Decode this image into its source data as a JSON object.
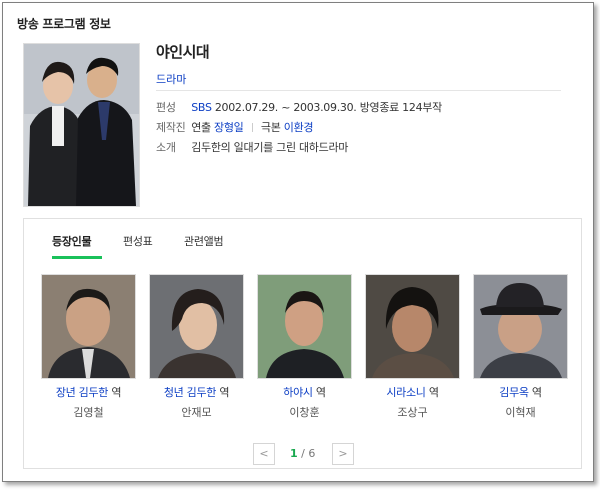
{
  "header": {
    "title": "방송 프로그램 정보"
  },
  "program": {
    "title": "야인시대",
    "genre": "드라마",
    "schedule_label": "편성",
    "network": "SBS",
    "schedule_text": "2002.07.29. ~ 2003.09.30. 방영종료 124부작",
    "staff_label": "제작진",
    "director_label": "연출",
    "director": "장형일",
    "writer_label": "극본",
    "writer": "이환경",
    "intro_label": "소개",
    "intro": "김두한의 일대기를 그린 대하드라마"
  },
  "tabs": [
    {
      "label": "등장인물",
      "active": true
    },
    {
      "label": "편성표",
      "active": false
    },
    {
      "label": "관련앨범",
      "active": false
    }
  ],
  "cast": [
    {
      "character": "장년 김두한",
      "role": "역",
      "actor": "김영철"
    },
    {
      "character": "청년 김두한",
      "role": "역",
      "actor": "안재모"
    },
    {
      "character": "하야시",
      "role": "역",
      "actor": "이창훈"
    },
    {
      "character": "시라소니",
      "role": "역",
      "actor": "조상구"
    },
    {
      "character": "김무옥",
      "role": "역",
      "actor": "이혁재"
    }
  ],
  "pager": {
    "current": "1",
    "separator": "/",
    "total": "6",
    "prev": "<",
    "next": ">"
  }
}
